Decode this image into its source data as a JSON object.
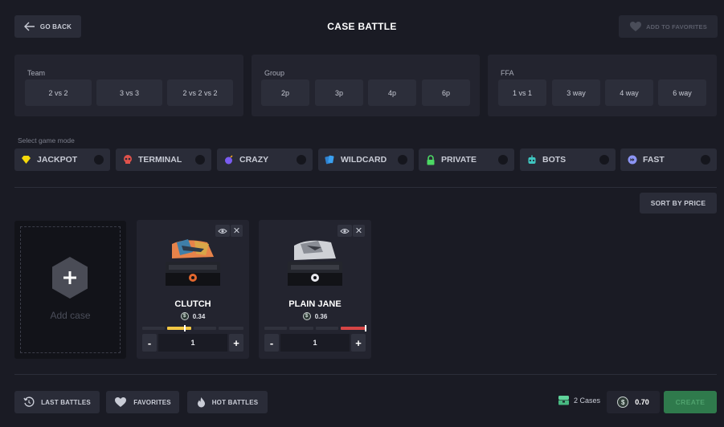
{
  "header": {
    "back_label": "GO BACK",
    "title": "CASE BATTLE",
    "favorite_label": "ADD TO FAVORITES"
  },
  "team_panel": {
    "title": "Team",
    "options": [
      "2 vs 2",
      "3 vs 3",
      "2 vs 2 vs 2"
    ]
  },
  "group_panel": {
    "title": "Group",
    "options": [
      "2p",
      "3p",
      "4p",
      "6p"
    ]
  },
  "ffa_panel": {
    "title": "FFA",
    "options": [
      "1 vs 1",
      "3 way",
      "4 way",
      "6 way"
    ]
  },
  "game_mode": {
    "label": "Select game mode",
    "modes": [
      {
        "label": "JACKPOT",
        "icon": "diamond-icon",
        "color": "#f5d90a"
      },
      {
        "label": "TERMINAL",
        "icon": "skull-icon",
        "color": "#e0524b"
      },
      {
        "label": "CRAZY",
        "icon": "bomb-icon",
        "color": "#7a5cf0"
      },
      {
        "label": "WILDCARD",
        "icon": "cards-icon",
        "color": "#3aa0f0"
      },
      {
        "label": "PRIVATE",
        "icon": "lock-icon",
        "color": "#4cd964"
      },
      {
        "label": "BOTS",
        "icon": "robot-icon",
        "color": "#3fc7c1"
      },
      {
        "label": "FAST",
        "icon": "fast-forward-icon",
        "color": "#8c95f5"
      }
    ]
  },
  "sort_label": "SORT BY PRICE",
  "add_case_label": "Add case",
  "cases": [
    {
      "name": "CLUTCH",
      "price": "0.34",
      "quantity": "1",
      "bar_color": "#f2c744"
    },
    {
      "name": "PLAIN JANE",
      "price": "0.36",
      "quantity": "1",
      "bar_color": "#d64545"
    }
  ],
  "footer": {
    "last_battles": "LAST BATTLES",
    "favorites": "FAVORITES",
    "hot_battles": "HOT BATTLES",
    "cases_count": "2 Cases",
    "total": "0.70",
    "create": "CREATE"
  },
  "colors": {
    "background": "#1a1b24",
    "panel": "#23242f",
    "create": "#2f7a4c"
  }
}
